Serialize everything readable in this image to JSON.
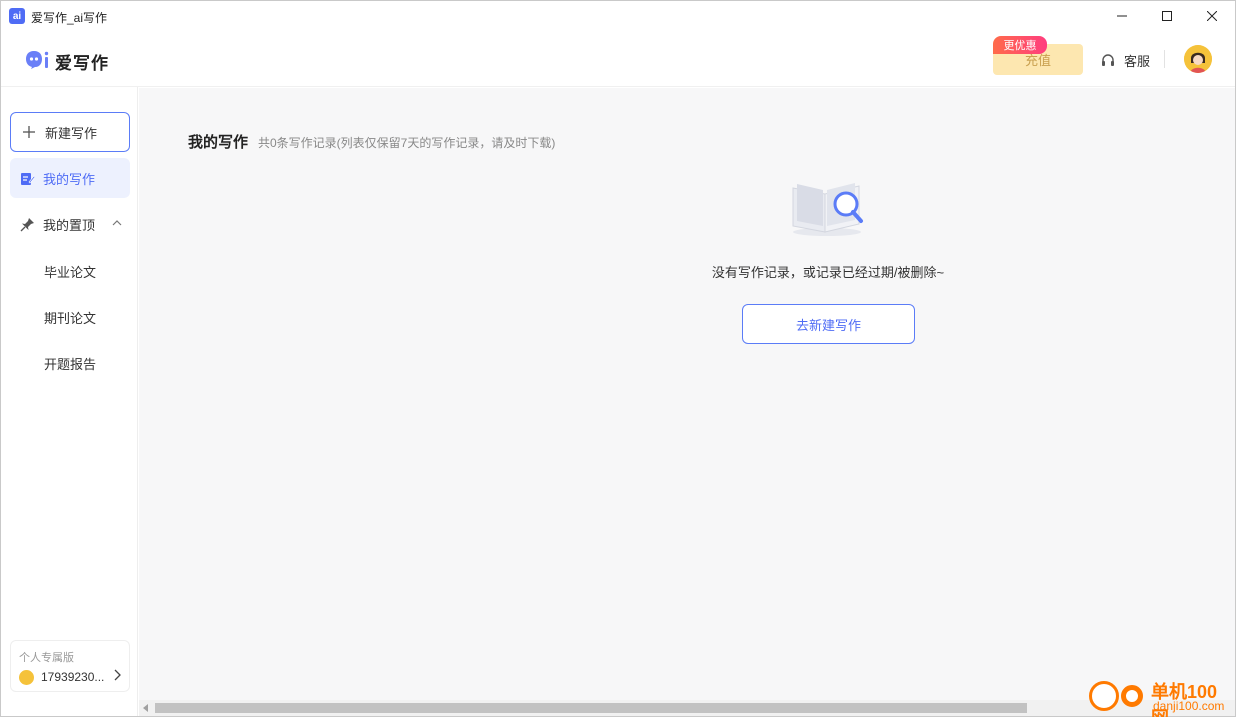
{
  "window": {
    "title": "爱写作_ai写作"
  },
  "header": {
    "brand_name": "爱写作",
    "recharge_label": "充值",
    "promo_badge": "更优惠",
    "service_label": "客服"
  },
  "sidebar": {
    "new_writing_label": "新建写作",
    "items": [
      {
        "label": "我的写作",
        "icon": "edit-icon",
        "active": true
      },
      {
        "label": "我的置顶",
        "icon": "pin-icon",
        "active": false
      }
    ],
    "sub_items": [
      {
        "label": "毕业论文"
      },
      {
        "label": "期刊论文"
      },
      {
        "label": "开题报告"
      }
    ],
    "account": {
      "edition": "个人专属版",
      "user_id": "17939230..."
    }
  },
  "main": {
    "title": "我的写作",
    "subtitle": "共0条写作记录(列表仅保留7天的写作记录，请及时下载)",
    "empty_text": "没有写作记录，或记录已经过期/被删除~",
    "go_new_label": "去新建写作"
  },
  "watermark": {
    "text_cn": "单机100网",
    "text_url": "danji100.com"
  },
  "colors": {
    "accent": "#4f6cf5",
    "recharge_bg": "#fde7b0",
    "promo_gradient_start": "#ff6b4a",
    "promo_gradient_end": "#ff3d7f"
  }
}
